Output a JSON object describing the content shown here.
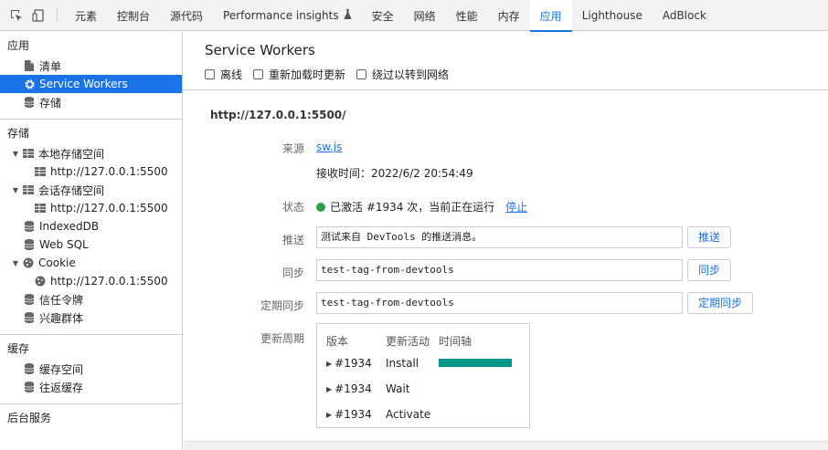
{
  "toolbar": {
    "inspect_icon": "inspect-element-icon",
    "device_icon": "device-toolbar-icon",
    "tabs": [
      {
        "label": "元素"
      },
      {
        "label": "控制台"
      },
      {
        "label": "源代码"
      },
      {
        "label": "Performance insights",
        "icon": "flask-icon"
      },
      {
        "label": "安全"
      },
      {
        "label": "网络"
      },
      {
        "label": "性能"
      },
      {
        "label": "内存"
      },
      {
        "label": "应用",
        "active": true
      },
      {
        "label": "Lighthouse"
      },
      {
        "label": "AdBlock"
      }
    ]
  },
  "sidebar": {
    "app_section": {
      "title": "应用",
      "items": [
        {
          "label": "清单",
          "icon": "file-icon"
        },
        {
          "label": "Service Workers",
          "icon": "gear-icon",
          "selected": true
        },
        {
          "label": "存储",
          "icon": "database-icon"
        }
      ]
    },
    "storage_section": {
      "title": "存储",
      "local_storage": {
        "label": "本地存储空间",
        "child": "http://127.0.0.1:5500"
      },
      "session_storage": {
        "label": "会话存储空间",
        "child": "http://127.0.0.1:5500"
      },
      "indexeddb": "IndexedDB",
      "websql": "Web SQL",
      "cookie": {
        "label": "Cookie",
        "child": "http://127.0.0.1:5500"
      },
      "trust_tokens": "信任令牌",
      "interest_groups": "兴趣群体"
    },
    "cache_section": {
      "title": "缓存",
      "cache_storage": "缓存空间",
      "back_forward_cache": "往返缓存"
    },
    "background_section": {
      "title": "后台服务"
    }
  },
  "main": {
    "title": "Service Workers",
    "options": [
      {
        "label": "离线",
        "checked": false
      },
      {
        "label": "重新加载时更新",
        "checked": false
      },
      {
        "label": "绕过以转到网络",
        "checked": false
      }
    ],
    "origin": "http://127.0.0.1:5500/",
    "source": {
      "label": "来源",
      "link": "sw.js",
      "received": "接收时间：2022/6/2 20:54:49"
    },
    "status": {
      "label": "状态",
      "text": "已激活 #1934 次，当前正在运行",
      "stop": "停止",
      "color": "#2e9e47"
    },
    "push": {
      "label": "推送",
      "value": "测试来自 DevTools 的推送消息。",
      "button": "推送"
    },
    "sync": {
      "label": "同步",
      "value": "test-tag-from-devtools",
      "button": "同步"
    },
    "periodic_sync": {
      "label": "定期同步",
      "value": "test-tag-from-devtools",
      "button": "定期同步"
    },
    "update_cycle": {
      "label": "更新周期",
      "headers": [
        "版本",
        "更新活动",
        "时间轴"
      ],
      "rows": [
        {
          "version": "#1934",
          "activity": "Install"
        },
        {
          "version": "#1934",
          "activity": "Wait"
        },
        {
          "version": "#1934",
          "activity": "Activate"
        }
      ],
      "bar_color": "#009688"
    }
  },
  "colors": {
    "accent": "#1a73e8",
    "selected_bg": "#1a73e8",
    "status_green": "#2e9e47",
    "timeline": "#009688"
  }
}
